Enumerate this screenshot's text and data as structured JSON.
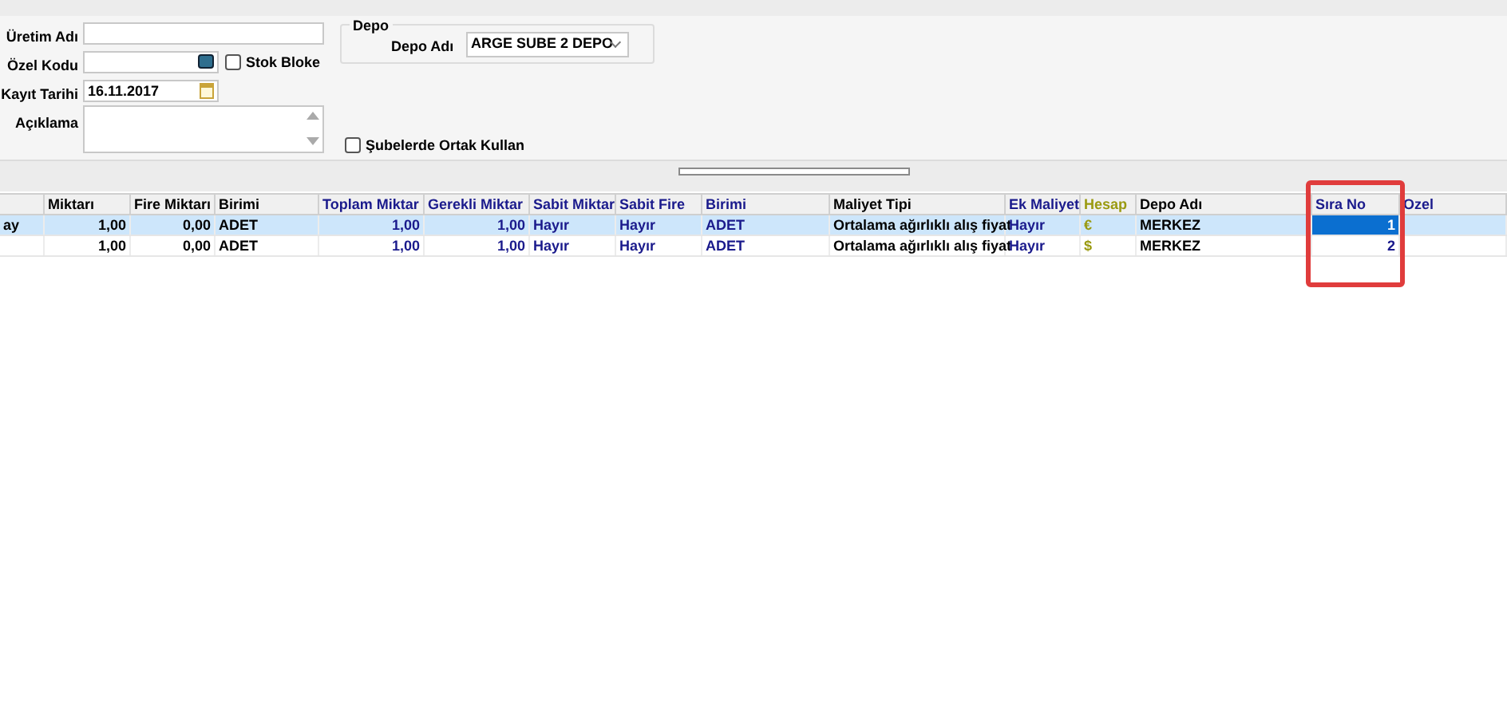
{
  "form": {
    "uretim_adi": {
      "label": "Üretim Adı"
    },
    "ozel_kodu": {
      "label": "Özel Kodu"
    },
    "stok_bloke": {
      "label": "Stok Bloke",
      "checked": false
    },
    "kayit_tarihi": {
      "label": "Kayıt Tarihi",
      "value": "16.11.2017"
    },
    "aciklama": {
      "label": "Açıklama"
    }
  },
  "depo": {
    "title": "Depo",
    "label": "Depo Adı",
    "value": "ARGE SUBE 2 DEPO"
  },
  "subelerde": {
    "label": "Şubelerde Ortak Kullan",
    "checked": false
  },
  "table": {
    "columns": [
      {
        "kind": "plain"
      },
      {
        "label": "Miktarı",
        "kind": "plain"
      },
      {
        "label": "Fire Miktarı",
        "kind": "plain"
      },
      {
        "label": "Birimi",
        "kind": "plain"
      },
      {
        "label": "Toplam Miktar",
        "kind": "linked"
      },
      {
        "label": "Gerekli Miktar",
        "kind": "linked"
      },
      {
        "label": "Sabit Miktar",
        "kind": "linked"
      },
      {
        "label": "Sabit Fire",
        "kind": "linked"
      },
      {
        "label": "Birimi",
        "kind": "linked"
      },
      {
        "label": "Maliyet Tipi",
        "kind": "plain"
      },
      {
        "label": "Ek Maliyet",
        "kind": "linked"
      },
      {
        "label": "Hesap",
        "kind": "account"
      },
      {
        "label": "Depo Adı",
        "kind": "plain"
      },
      {
        "label": "Sıra No",
        "kind": "linked"
      },
      {
        "label": "Ozel",
        "kind": "linked"
      }
    ],
    "rows": [
      {
        "selected": true,
        "sira_no_focused": true,
        "cells": [
          "ay",
          "1,00",
          "0,00",
          "ADET",
          "1,00",
          "1,00",
          "Hayır",
          "Hayır",
          "ADET",
          "Ortalama ağırlıklı alış fiyat",
          "Hayır",
          "€",
          "MERKEZ",
          "1",
          null
        ]
      },
      {
        "selected": false,
        "sira_no_focused": false,
        "cells": [
          null,
          "1,00",
          "0,00",
          "ADET",
          "1,00",
          "1,00",
          "Hayır",
          "Hayır",
          "ADET",
          "Ortalama ağırlıklı alış fiyat",
          "Hayır",
          "$",
          "MERKEZ",
          "2",
          null
        ]
      }
    ]
  },
  "highlight": {
    "shown": true
  }
}
